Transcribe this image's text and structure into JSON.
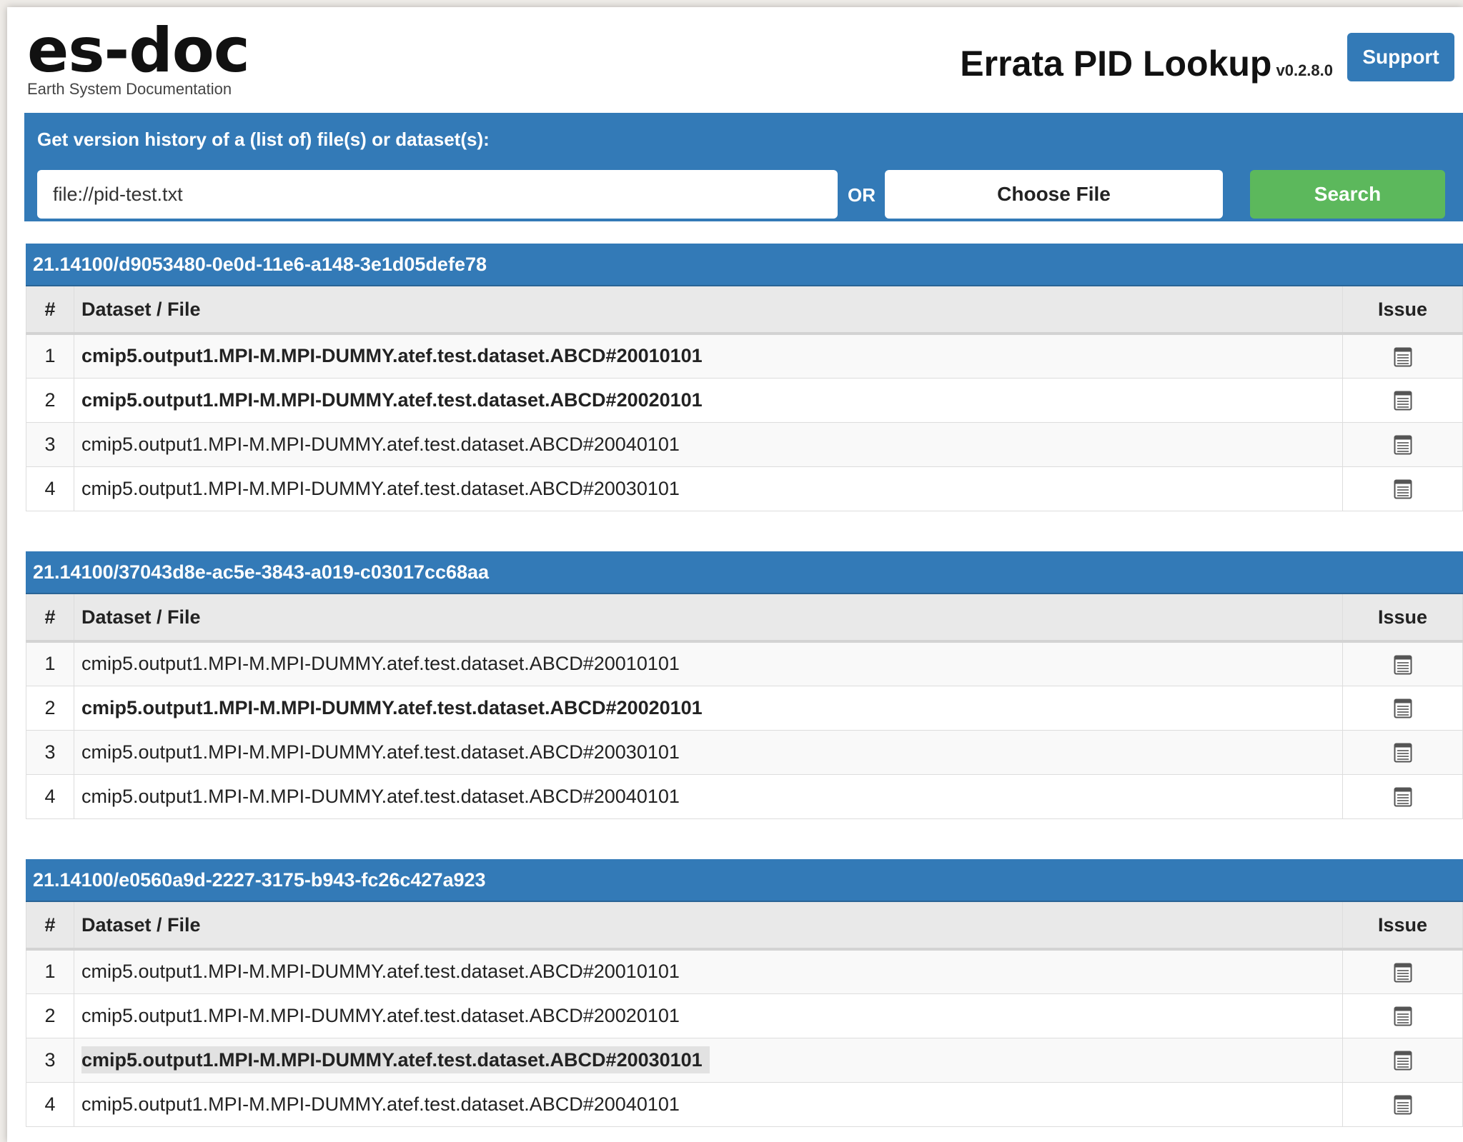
{
  "header": {
    "logo_main": "es-doc",
    "logo_sub": "Earth System Documentation",
    "app_title": "Errata PID Lookup",
    "version": "v0.2.8.0",
    "support_label": "Support"
  },
  "search": {
    "label": "Get version history of a (list of) file(s) or dataset(s):",
    "input_value": "file://pid-test.txt",
    "or_text": "OR",
    "choose_file_label": "Choose File",
    "search_label": "Search"
  },
  "table_headers": {
    "num": "#",
    "dataset": "Dataset / File",
    "issue": "Issue"
  },
  "results": [
    {
      "pid": "21.14100/d9053480-0e0d-11e6-a148-3e1d05defe78",
      "rows": [
        {
          "num": "1",
          "dataset": "cmip5.output1.MPI-M.MPI-DUMMY.atef.test.dataset.ABCD#20010101",
          "bold": true
        },
        {
          "num": "2",
          "dataset": "cmip5.output1.MPI-M.MPI-DUMMY.atef.test.dataset.ABCD#20020101",
          "bold": true
        },
        {
          "num": "3",
          "dataset": "cmip5.output1.MPI-M.MPI-DUMMY.atef.test.dataset.ABCD#20040101",
          "bold": false
        },
        {
          "num": "4",
          "dataset": "cmip5.output1.MPI-M.MPI-DUMMY.atef.test.dataset.ABCD#20030101",
          "bold": false
        }
      ]
    },
    {
      "pid": "21.14100/37043d8e-ac5e-3843-a019-c03017cc68aa",
      "rows": [
        {
          "num": "1",
          "dataset": "cmip5.output1.MPI-M.MPI-DUMMY.atef.test.dataset.ABCD#20010101",
          "bold": false
        },
        {
          "num": "2",
          "dataset": "cmip5.output1.MPI-M.MPI-DUMMY.atef.test.dataset.ABCD#20020101",
          "bold": true
        },
        {
          "num": "3",
          "dataset": "cmip5.output1.MPI-M.MPI-DUMMY.atef.test.dataset.ABCD#20030101",
          "bold": false
        },
        {
          "num": "4",
          "dataset": "cmip5.output1.MPI-M.MPI-DUMMY.atef.test.dataset.ABCD#20040101",
          "bold": false
        }
      ]
    },
    {
      "pid": "21.14100/e0560a9d-2227-3175-b943-fc26c427a923",
      "rows": [
        {
          "num": "1",
          "dataset": "cmip5.output1.MPI-M.MPI-DUMMY.atef.test.dataset.ABCD#20010101",
          "bold": false
        },
        {
          "num": "2",
          "dataset": "cmip5.output1.MPI-M.MPI-DUMMY.atef.test.dataset.ABCD#20020101",
          "bold": false
        },
        {
          "num": "3",
          "dataset": "cmip5.output1.MPI-M.MPI-DUMMY.atef.test.dataset.ABCD#20030101",
          "bold": true,
          "highlighted": true
        },
        {
          "num": "4",
          "dataset": "cmip5.output1.MPI-M.MPI-DUMMY.atef.test.dataset.ABCD#20040101",
          "bold": false
        }
      ]
    }
  ],
  "icons": {
    "issue": "list-document-icon"
  },
  "colors": {
    "primary": "#337ab7",
    "success": "#5cb85c"
  }
}
